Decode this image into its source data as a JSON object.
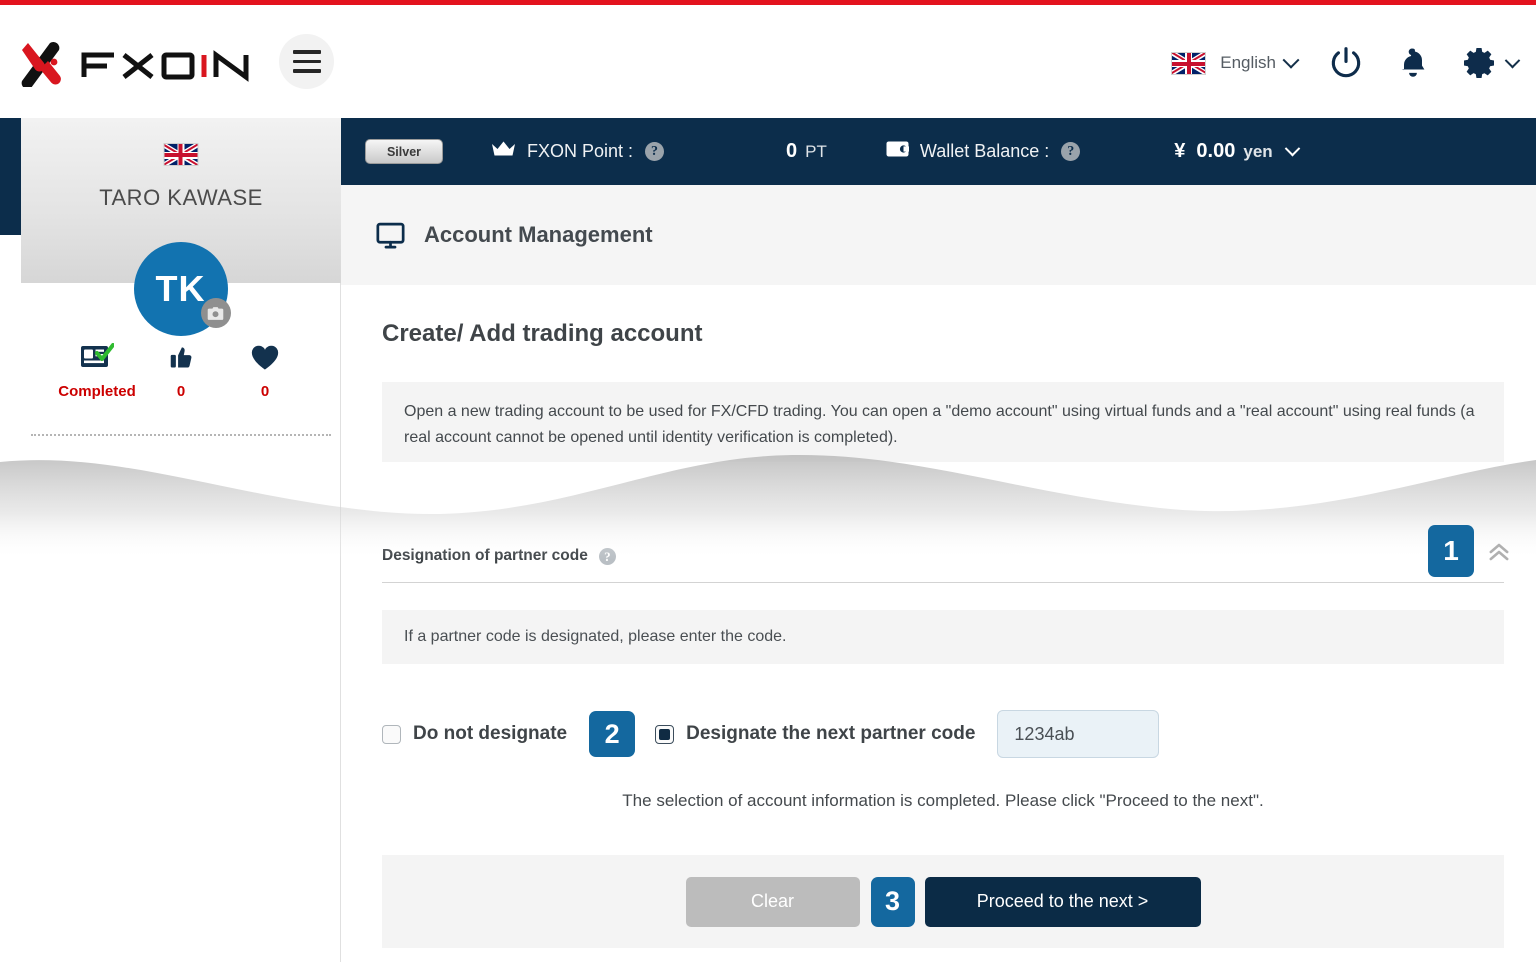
{
  "brand": {
    "name": "FXON",
    "logo_icon": "fxon-logo-icon"
  },
  "header": {
    "menu_icon": "hamburger-menu-icon",
    "language": {
      "label": "English",
      "flag_icon": "uk-flag-icon",
      "chevron_icon": "chevron-down-icon"
    },
    "power_icon": "power-icon",
    "bell_icon": "bell-notification-icon",
    "gear_icon": "gear-settings-icon",
    "gear_chevron_icon": "chevron-down-icon",
    "accent_red": "#e3131e"
  },
  "sidebar": {
    "flag_icon": "uk-flag-icon",
    "user_name": "TARO KAWASE",
    "avatar_initials": "TK",
    "avatar_color": "#1273b0",
    "camera_icon": "camera-icon",
    "stats": [
      {
        "icon": "id-card-verified-icon",
        "value": "Completed",
        "value_color": "#cc0000"
      },
      {
        "icon": "thumbs-up-icon",
        "value": "0",
        "value_color": "#cc0000"
      },
      {
        "icon": "heart-icon",
        "value": "0",
        "value_color": "#cc0000"
      }
    ]
  },
  "account_bar": {
    "tier": "Silver",
    "point": {
      "icon": "crown-icon",
      "label": "FXON Point :",
      "help_icon": "help-icon",
      "value": "0",
      "unit": "PT"
    },
    "wallet": {
      "icon": "wallet-icon",
      "label": "Wallet Balance :",
      "help_icon": "help-icon",
      "currency_symbol": "¥",
      "value": "0.00",
      "unit": "yen",
      "chevron_icon": "chevron-down-icon"
    },
    "background": "#0c2d4b"
  },
  "page": {
    "icon": "monitor-screen-icon",
    "title": "Account Management",
    "section_title": "Create/ Add trading account",
    "info_text": "Open a new trading account to be used for FX/CFD trading. You can open a \"demo account\" using virtual funds and a \"real account\" using real funds (a real account cannot be opened until identity verification is completed)."
  },
  "partner_section": {
    "heading": "Designation of partner code",
    "help_icon": "help-icon",
    "step_badge": "1",
    "collapse_icon": "double-chevron-up-icon",
    "hint": "If a partner code is designated, please enter the code.",
    "options": [
      {
        "label": "Do not designate",
        "checked": false
      },
      {
        "label": "Designate the next partner code",
        "checked": true
      }
    ],
    "step_badge_2": "2",
    "code_input": {
      "value": "1234ab",
      "placeholder": "1234ab"
    },
    "completion_message": "The selection of account information is completed. Please click \"Proceed to the next\".",
    "badge_color": "#14689f"
  },
  "actions": {
    "clear_label": "Clear",
    "step_badge_3": "3",
    "proceed_label": "Proceed to the next >"
  }
}
